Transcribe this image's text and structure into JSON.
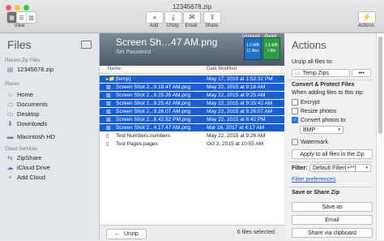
{
  "window": {
    "title": "12345678.zip"
  },
  "toolbar": {
    "view_label": "View",
    "view_icons": [
      "grid-icon",
      "list-icon",
      "columns-icon"
    ],
    "buttons": [
      {
        "label": "Add",
        "glyph": "+"
      },
      {
        "label": "Unzip",
        "glyph": "⤓"
      },
      {
        "label": "Email",
        "glyph": "✉"
      },
      {
        "label": "Share",
        "glyph": "⇪"
      }
    ],
    "actions_label": "Actions",
    "actions_glyph": "⚡"
  },
  "sidebar": {
    "title": "Files",
    "recent_header": "Recent Zip Files",
    "recent_items": [
      "12345678.zip"
    ],
    "places_header": "Places",
    "places": [
      "Home",
      "Documents",
      "Desktop",
      "Downloads",
      "Macintosh HD"
    ],
    "cloud_header": "Cloud Services",
    "cloud": [
      "ZipShare",
      "iCloud Drive",
      "Add Cloud"
    ]
  },
  "preview": {
    "filename": "Screen Sh…47 AM.png",
    "password": "Set Password",
    "unzipped_label": "Unzipped",
    "zipped_label": "Zipped",
    "unzipped_size": "1.6 MB",
    "unzipped_files": "11 files",
    "zipped_size": "1.5 MB",
    "zipped_files": "1 file"
  },
  "file_list": {
    "col_name": "Name",
    "col_date": "Date Modified",
    "rows": [
      {
        "name": "[temp]",
        "date": "May 17, 2019 at 1:52:32 PM",
        "selected": true,
        "icon": "folder"
      },
      {
        "name": "Screen Shot 2...9.18.47 AM.png",
        "date": "May 22, 2015 at 9:18 AM",
        "selected": true,
        "icon": "image"
      },
      {
        "name": "Screen Shot 2...9.25.35 AM.png",
        "date": "May 22, 2015 at 9:25 AM",
        "selected": true,
        "icon": "image"
      },
      {
        "name": "Screen Shot 2...9.25.42 AM.png",
        "date": "May 22, 2015 at 9:25:42 AM",
        "selected": true,
        "icon": "image"
      },
      {
        "name": "Screen Shot 2...9.26.07 AM.png",
        "date": "May 22, 2015 at 9:26:07 AM",
        "selected": true,
        "icon": "image"
      },
      {
        "name": "Screen Shot 2...6.42.52 PM.png",
        "date": "May 22, 2015 at 6:42 PM",
        "selected": true,
        "icon": "image"
      },
      {
        "name": "Screen Shot 2...4.17.47 AM.png",
        "date": "Mar 16, 2017 at 4:17 AM",
        "selected": true,
        "icon": "image"
      },
      {
        "name": "Test Numbers.numbers",
        "date": "May 22, 2015 at 9:26 AM",
        "selected": false,
        "icon": "doc"
      },
      {
        "name": "Test Pages.pages",
        "date": "Oct 2, 2015 at 10:55 AM",
        "selected": false,
        "icon": "doc"
      }
    ]
  },
  "bottom_bar": {
    "unzip_label": "Unzip",
    "status": "6 files selected"
  },
  "actions": {
    "title": "Actions",
    "unzip_all_label": "Unzip all files to:",
    "folder": "Temp Zips",
    "convert_header": "Convert & Protect Files",
    "when_adding": "When adding files to this zip:",
    "encrypt": "Encrypt",
    "resize": "Resize photos",
    "convert": "Convert photos to:",
    "format": "BMP",
    "watermark": "Watermark",
    "apply_all": "Apply to all files in the Zip",
    "filter_label": "Filter:",
    "filter_value": "Default Filter(+**)",
    "filter_prefs": "Filter preferences",
    "save_header": "Save or Share Zip",
    "save_as": "Save as",
    "email": "Email",
    "share_clip": "Share via clipboard"
  }
}
